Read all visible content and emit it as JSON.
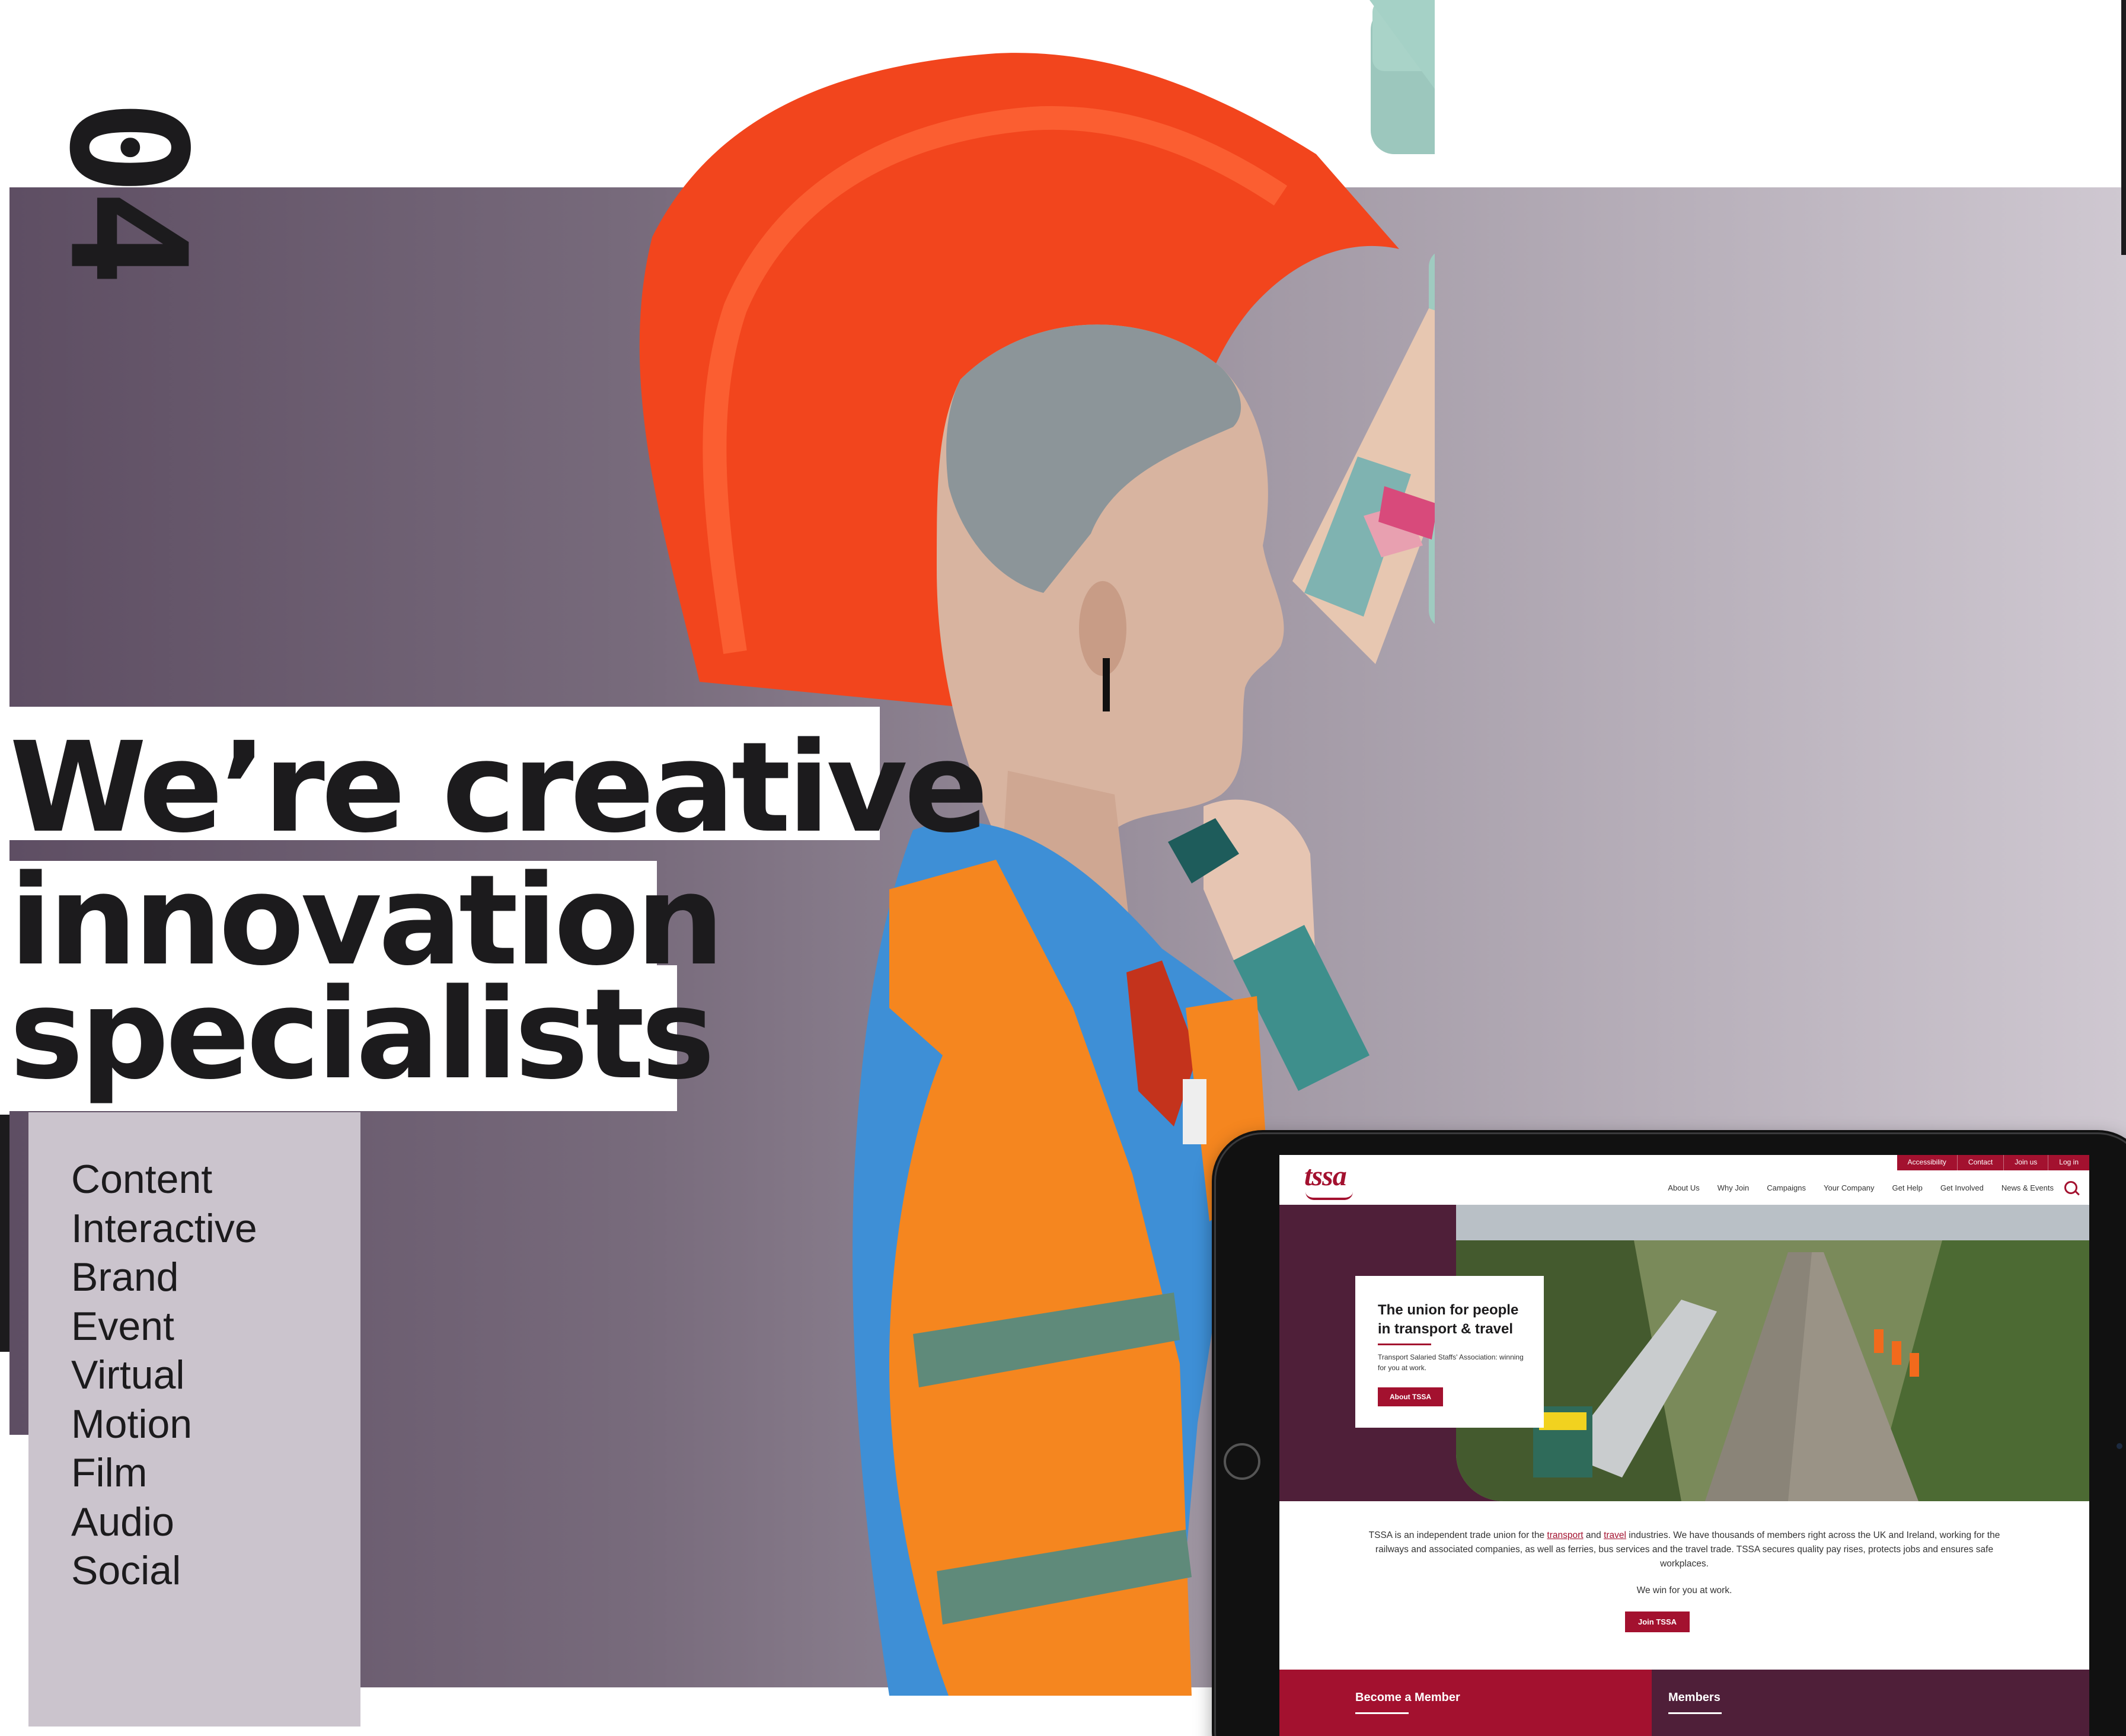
{
  "section_number": "04",
  "headline": {
    "line1": "We’re creative",
    "line2": "innovation",
    "line3": "specialists"
  },
  "services": [
    "Content",
    "Interactive",
    "Brand",
    "Event",
    "Virtual",
    "Motion",
    "Film",
    "Audio",
    "Social"
  ],
  "colors": {
    "accent_yellow": "#f5b400",
    "purple_backdrop": "#786b7c",
    "panel_lilac": "#cbc4cd",
    "tssa_red": "#a3112f",
    "tssa_plum": "#4f1f39"
  },
  "tablet_site": {
    "logo": "tssa",
    "utility_links": [
      "Accessibility",
      "Contact",
      "Join us",
      "Log in"
    ],
    "nav_items": [
      "About Us",
      "Why Join",
      "Campaigns",
      "Your Company",
      "Get Help",
      "Get Involved",
      "News & Events"
    ],
    "hero_title": "The union for people in transport & travel",
    "hero_subtitle": "Transport Salaried Staffs' Association: winning for you at work.",
    "hero_button": "About TSSA",
    "intro_before": "TSSA is an independent trade union for the ",
    "intro_link1": "transport",
    "intro_mid": " and ",
    "intro_link2": "travel",
    "intro_after": " industries. We have thousands of members right across the UK and Ireland, working for the railways and associated companies, as well as ferries, bus services and the travel trade. TSSA secures quality pay rises, protects jobs and ensures safe workplaces.",
    "tagline": "We win for you at work.",
    "join_button": "Join TSSA",
    "panel_left_title": "Become a Member",
    "panel_right_title": "Members"
  }
}
